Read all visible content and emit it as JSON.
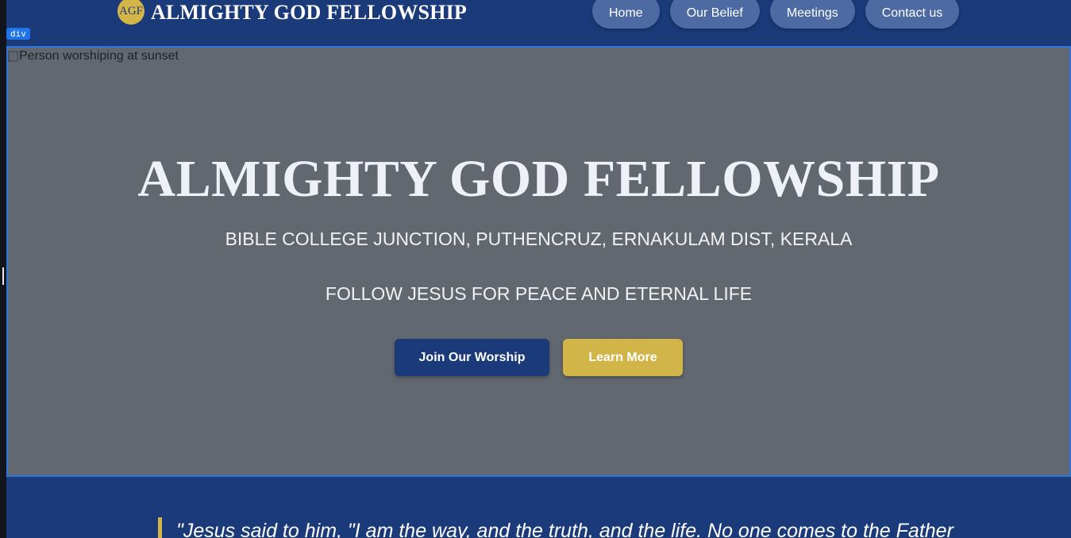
{
  "header": {
    "logo_text": "AGF",
    "brand_name": "ALMIGHTY GOD FELLOWSHIP",
    "nav": [
      {
        "label": "Home"
      },
      {
        "label": "Our Belief"
      },
      {
        "label": "Meetings"
      },
      {
        "label": "Contact us"
      }
    ]
  },
  "devtools": {
    "element_badge": "div"
  },
  "hero": {
    "image_alt": "Person worshiping at sunset",
    "title": "ALMIGHTY GOD FELLOWSHIP",
    "address": "BIBLE COLLEGE JUNCTION, PUTHENCRUZ, ERNAKULAM DIST, KERALA",
    "tagline": "FOLLOW JESUS FOR PEACE AND ETERNAL LIFE",
    "primary_button": "Join Our Worship",
    "secondary_button": "Learn More"
  },
  "quote": {
    "text": "\"Jesus said to him, \"I am the way, and the truth, and the life. No one comes to the Father"
  },
  "colors": {
    "brand_blue": "#1a3a7a",
    "gold": "#d4b548",
    "nav_pill": "#4d6aa3",
    "hero_overlay": "#626870",
    "selection_outline": "#2d74e0"
  }
}
